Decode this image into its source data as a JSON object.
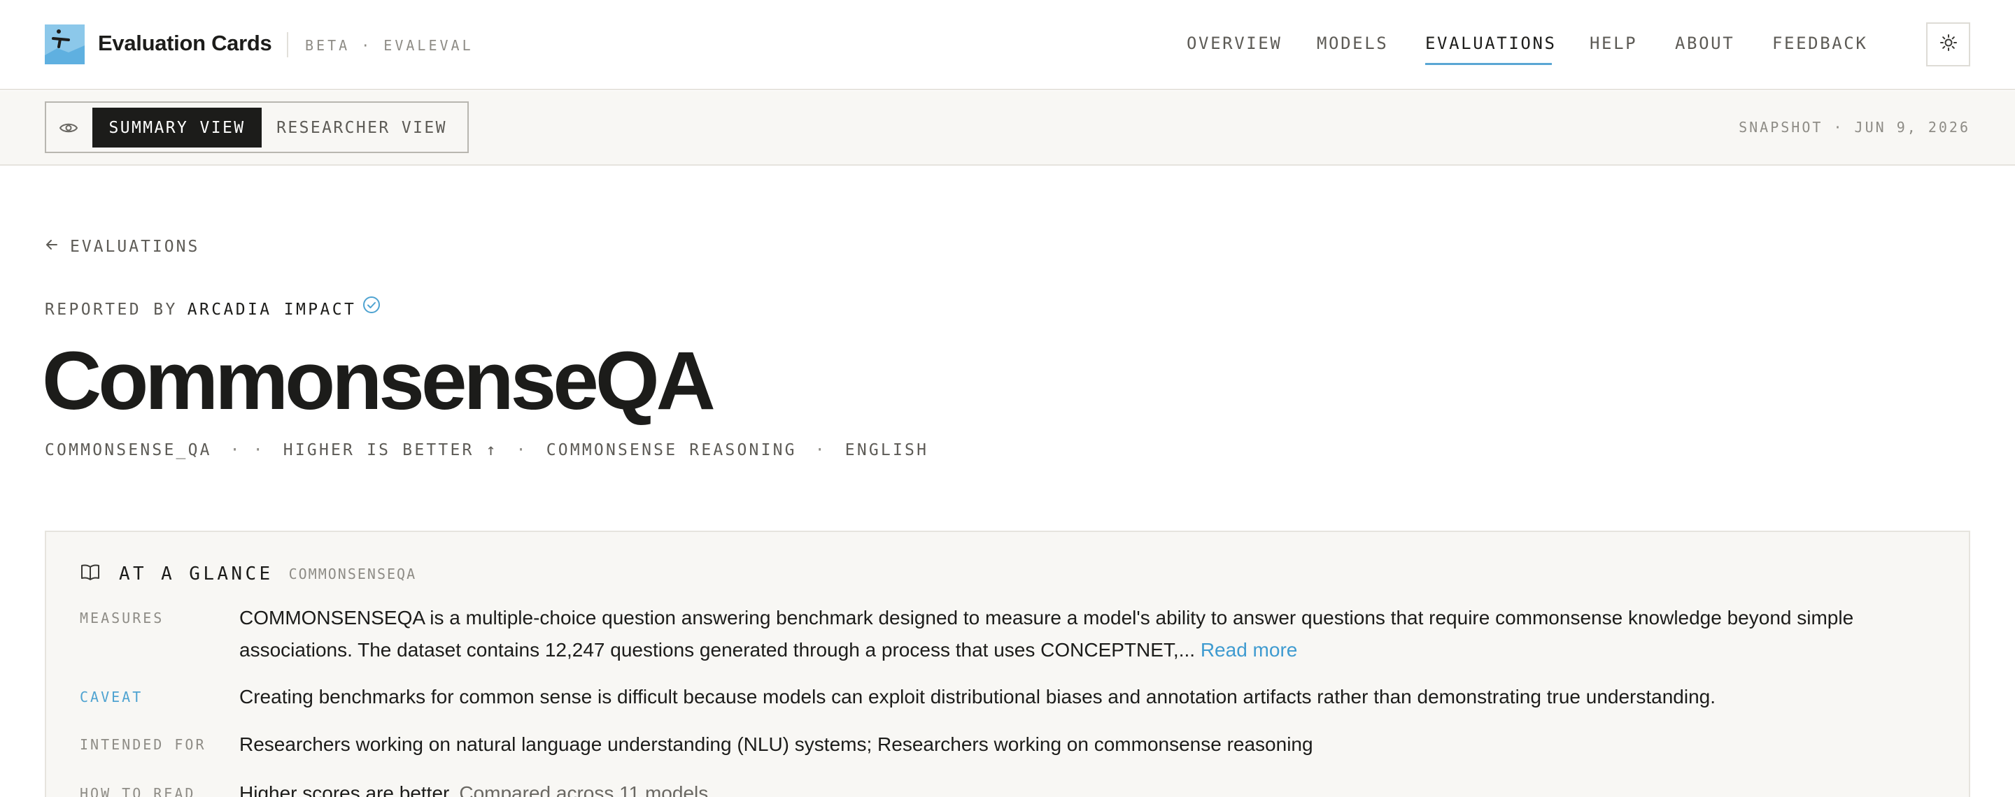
{
  "header": {
    "app_title": "Evaluation Cards",
    "tagline": "BETA · EVALEVAL",
    "nav": [
      "OVERVIEW",
      "MODELS",
      "EVALUATIONS",
      "HELP",
      "ABOUT",
      "FEEDBACK"
    ],
    "active_nav": "EVALUATIONS",
    "theme_icon": "sun-icon"
  },
  "subbar": {
    "views": [
      "SUMMARY VIEW",
      "RESEARCHER VIEW"
    ],
    "active_view": "SUMMARY VIEW",
    "snapshot": "SNAPSHOT · JUN 9, 2026"
  },
  "breadcrumb": {
    "back_label": "EVALUATIONS"
  },
  "eval": {
    "reported_by_label": "REPORTED BY",
    "reported_by": "ARCADIA IMPACT",
    "title": "CommonsenseQA",
    "meta": {
      "id": "COMMONSENSE_QA",
      "direction": "HIGHER IS BETTER ↑",
      "task": "COMMONSENSE REASONING",
      "language": "ENGLISH"
    }
  },
  "glance": {
    "heading": "AT A GLANCE",
    "subheading": "COMMONSENSEQA",
    "rows": [
      {
        "label": "MEASURES",
        "text": "COMMONSENSEQA is a multiple-choice question answering benchmark designed to measure a model's ability to answer questions that require commonsense knowledge beyond simple associations. The dataset contains 12,247 questions generated through a process that uses CONCEPTNET,...",
        "link": "Read more"
      },
      {
        "label": "CAVEAT",
        "text": "Creating benchmarks for common sense is difficult because models can exploit distributional biases and annotation artifacts rather than demonstrating true understanding."
      },
      {
        "label": "INTENDED FOR",
        "text": "Researchers working on natural language understanding (NLU) systems; Researchers working on commonsense reasoning"
      },
      {
        "label": "HOW TO READ",
        "text": "Higher scores are better.",
        "extra": "Compared across 11 models."
      }
    ]
  },
  "colors": {
    "accent": "#5aa6d4",
    "link": "#3f9bd0",
    "ink": "#1c1c1a",
    "panel": "#f8f7f4"
  }
}
